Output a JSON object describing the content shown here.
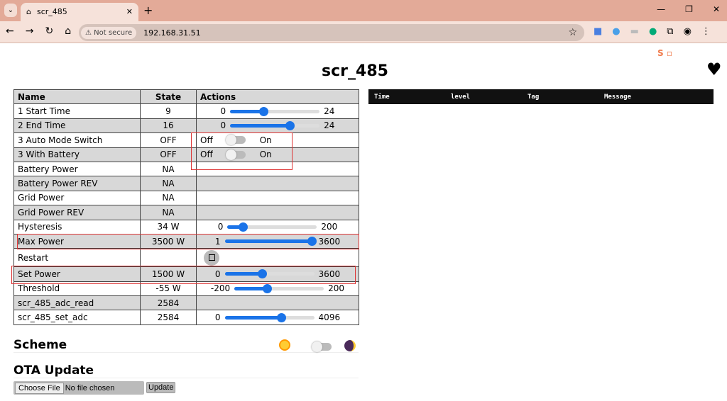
{
  "browser": {
    "tab_title": "scr_485",
    "not_secure": "Not secure",
    "url": "192.168.31.51"
  },
  "page": {
    "title": "scr_485"
  },
  "table": {
    "headers": [
      "Name",
      "State",
      "Actions"
    ],
    "rows": [
      {
        "name": "1 Start Time",
        "state": "9",
        "type": "slider",
        "min": "0",
        "max": "24",
        "value": 9
      },
      {
        "name": "2 End Time",
        "state": "16",
        "type": "slider",
        "min": "0",
        "max": "24",
        "value": 16
      },
      {
        "name": "3 Auto Mode Switch",
        "state": "OFF",
        "type": "toggle",
        "off": "Off",
        "on": "On"
      },
      {
        "name": "3 With Battery",
        "state": "OFF",
        "type": "toggle",
        "off": "Off",
        "on": "On"
      },
      {
        "name": "Battery Power",
        "state": "NA",
        "type": "none"
      },
      {
        "name": "Battery Power REV",
        "state": "NA",
        "type": "none"
      },
      {
        "name": "Grid Power",
        "state": "NA",
        "type": "none"
      },
      {
        "name": "Grid Power REV",
        "state": "NA",
        "type": "none"
      },
      {
        "name": "Hysteresis",
        "state": "34 W",
        "type": "slider",
        "min": "0",
        "max": "200",
        "value": 34
      },
      {
        "name": "Max Power",
        "state": "3500 W",
        "type": "slider",
        "min": "1",
        "max": "3600",
        "value": 3500
      },
      {
        "name": "Restart",
        "state": "",
        "type": "button"
      },
      {
        "name": "Set Power",
        "state": "1500 W",
        "type": "slider",
        "min": "0",
        "max": "3600",
        "value": 1500
      },
      {
        "name": "Threshold",
        "state": "-55 W",
        "type": "slider",
        "min": "-200",
        "max": "200",
        "value": -55
      },
      {
        "name": "scr_485_adc_read",
        "state": "2584",
        "type": "none"
      },
      {
        "name": "scr_485_set_adc",
        "state": "2584",
        "type": "slider",
        "min": "0",
        "max": "4096",
        "value": 2584
      }
    ]
  },
  "log": {
    "headers": [
      "Time",
      "level",
      "Tag",
      "Message"
    ]
  },
  "scheme": {
    "title": "Scheme"
  },
  "ota": {
    "title": "OTA Update",
    "choose": "Choose File",
    "no_file": "No file chosen",
    "update": "Update"
  },
  "colors": {
    "accent": "#1a73e8",
    "highlight": "#dd3333"
  }
}
